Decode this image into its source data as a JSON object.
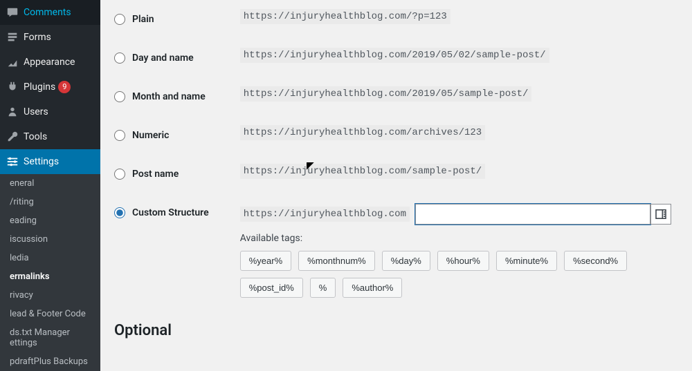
{
  "sidebar": {
    "items": [
      {
        "icon": "comments-icon",
        "label": "Comments"
      },
      {
        "icon": "forms-icon",
        "label": "Forms"
      },
      {
        "icon": "appearance-icon",
        "label": "Appearance"
      },
      {
        "icon": "plugins-icon",
        "label": "Plugins",
        "badge": "9"
      },
      {
        "icon": "users-icon",
        "label": "Users"
      },
      {
        "icon": "tools-icon",
        "label": "Tools"
      },
      {
        "icon": "settings-icon",
        "label": "Settings",
        "active": true
      }
    ],
    "submenu": [
      "eneral",
      "/riting",
      "eading",
      "iscussion",
      "ledia",
      "ermalinks",
      "rivacy",
      "lead & Footer Code",
      "ds.txt Manager ettings",
      "pdraftPlus Backups"
    ]
  },
  "permalinks": {
    "options": [
      {
        "key": "plain",
        "label": "Plain",
        "example": "https://injuryhealthblog.com/?p=123"
      },
      {
        "key": "day_name",
        "label": "Day and name",
        "example": "https://injuryhealthblog.com/2019/05/02/sample-post/"
      },
      {
        "key": "month_name",
        "label": "Month and name",
        "example": "https://injuryhealthblog.com/2019/05/sample-post/"
      },
      {
        "key": "numeric",
        "label": "Numeric",
        "example": "https://injuryhealthblog.com/archives/123"
      },
      {
        "key": "post_name",
        "label": "Post name",
        "example": "https://injuryhealthblog.com/sample-post/"
      }
    ],
    "custom": {
      "label": "Custom Structure",
      "prefix": "https://injuryhealthblog.com",
      "value": "",
      "available_label": "Available tags:",
      "tags": [
        "%year%",
        "%monthnum%",
        "%day%",
        "%hour%",
        "%minute%",
        "%second%",
        "%post_id%",
        "%",
        "%author%"
      ]
    }
  },
  "sections": {
    "optional": "Optional"
  }
}
